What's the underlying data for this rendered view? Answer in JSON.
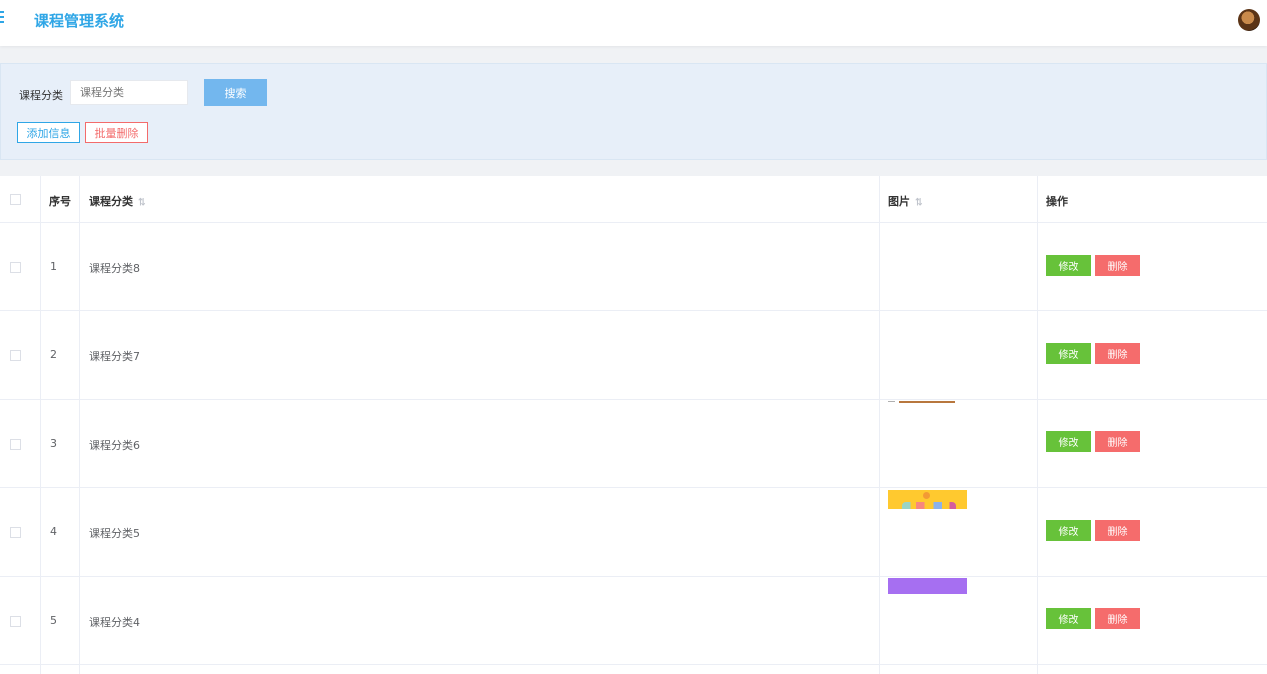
{
  "header": {
    "title": "课程管理系统"
  },
  "search": {
    "label": "课程分类",
    "placeholder": "课程分类",
    "button": "搜索"
  },
  "toolbar": {
    "add": "添加信息",
    "batch_delete": "批量删除"
  },
  "table": {
    "columns": {
      "index": "序号",
      "category": "课程分类",
      "image": "图片",
      "actions": "操作"
    },
    "rows": [
      {
        "index": "1",
        "category": "课程分类8",
        "edit": "修改",
        "delete": "删除"
      },
      {
        "index": "2",
        "category": "课程分类7",
        "edit": "修改",
        "delete": "删除"
      },
      {
        "index": "3",
        "category": "课程分类6",
        "edit": "修改",
        "delete": "删除"
      },
      {
        "index": "4",
        "category": "课程分类5",
        "edit": "修改",
        "delete": "删除"
      },
      {
        "index": "5",
        "category": "课程分类4",
        "edit": "修改",
        "delete": "删除"
      }
    ]
  },
  "colors": {
    "primary": "#2fa6e6",
    "edit": "#67c23a",
    "delete": "#f56c6c",
    "panel": "#e7eff9"
  },
  "icons": {
    "menu": "menu-icon",
    "sort": "sort-icon",
    "avatar": "user-avatar"
  }
}
